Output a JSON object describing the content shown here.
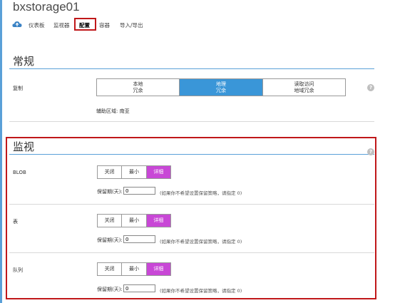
{
  "header": {
    "title": "bxstorage01",
    "tabs": [
      {
        "label": "仪表板"
      },
      {
        "label": "监视器"
      },
      {
        "label": "配置"
      },
      {
        "label": "容器"
      },
      {
        "label": "导入/导出"
      }
    ]
  },
  "general": {
    "title": "常规",
    "replication_label": "复制",
    "options": [
      {
        "line1": "本地",
        "line2": "冗余"
      },
      {
        "line1": "地理",
        "line2": "冗余"
      },
      {
        "line1": "读取访问",
        "line2": "地域冗余"
      }
    ],
    "selected": "地理冗余",
    "secondary_region": "辅助区域: 南亚"
  },
  "monitoring": {
    "title": "监视",
    "level_options": [
      "关闭",
      "最小",
      "详细"
    ],
    "retention_label": "保留期(天):",
    "hint": "(如果你不希望设置保留策略，请指定 0)",
    "rows": [
      {
        "label": "BLOB",
        "selected": "详细",
        "retention": "0"
      },
      {
        "label": "表",
        "selected": "详细",
        "retention": "0"
      },
      {
        "label": "队列",
        "selected": "详细",
        "retention": "0"
      }
    ]
  },
  "colors": {
    "accent_blue": "#3a96d8",
    "selected_purple": "#c847d6",
    "highlight_red": "#c0181a"
  },
  "icons": [
    "cloud-icon",
    "help-icon"
  ]
}
